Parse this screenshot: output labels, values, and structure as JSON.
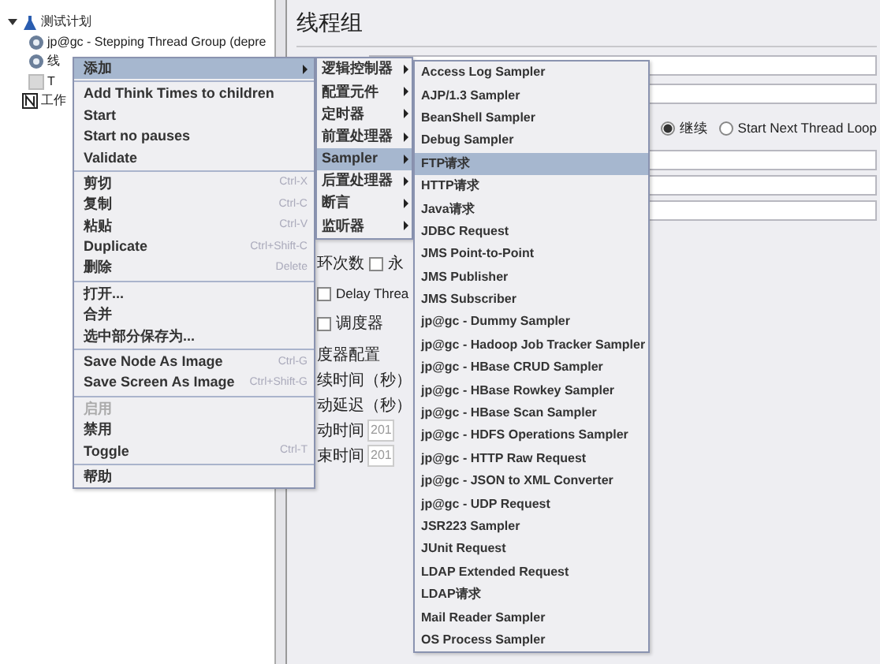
{
  "tree": [
    {
      "label": "测试计划",
      "kind": "plan",
      "expanded": true,
      "children": [
        {
          "label": "jp@gc - Stepping Thread Group (depre",
          "kind": "threads"
        },
        {
          "label": "线",
          "kind": "threads"
        },
        {
          "label": "T",
          "kind": "element"
        }
      ]
    },
    {
      "label": "工作",
      "kind": "workbench"
    }
  ],
  "panel": {
    "title": "线程组",
    "radios": [
      {
        "label": "继续",
        "selected": true
      },
      {
        "label": "Start Next Thread Loop",
        "selected": false
      }
    ],
    "loop_label": "环次数",
    "checkboxes": [
      {
        "label": "永",
        "checked": false
      },
      {
        "label": "Delay Threa",
        "checked": false
      },
      {
        "label": "调度器",
        "checked": false
      }
    ],
    "scheduler_config": "度器配置",
    "scheduler_fields": [
      {
        "label": "续时间（秒）"
      },
      {
        "label": "动延迟（秒）"
      },
      {
        "label": "动时间",
        "value": "201"
      },
      {
        "label": "束时间",
        "value": "201"
      }
    ]
  },
  "context_menu": [
    {
      "kind": "item",
      "label": "添加",
      "submenu": true,
      "selected": true,
      "disabled": false
    },
    {
      "kind": "separator"
    },
    {
      "kind": "item",
      "label": "Add Think Times to children",
      "selected": false,
      "disabled": false
    },
    {
      "kind": "item",
      "label": "Start",
      "selected": false,
      "disabled": false
    },
    {
      "kind": "item",
      "label": "Start no pauses",
      "selected": false,
      "disabled": false
    },
    {
      "kind": "item",
      "label": "Validate",
      "selected": false,
      "disabled": false
    },
    {
      "kind": "separator"
    },
    {
      "kind": "item",
      "label": "剪切",
      "shortcut": "Ctrl-X",
      "selected": false,
      "disabled": false
    },
    {
      "kind": "item",
      "label": "复制",
      "shortcut": "Ctrl-C",
      "selected": false,
      "disabled": false
    },
    {
      "kind": "item",
      "label": "粘贴",
      "shortcut": "Ctrl-V",
      "selected": false,
      "disabled": false
    },
    {
      "kind": "item",
      "label": "Duplicate",
      "shortcut": "Ctrl+Shift-C",
      "selected": false,
      "disabled": false
    },
    {
      "kind": "item",
      "label": "删除",
      "shortcut": "Delete",
      "selected": false,
      "disabled": false
    },
    {
      "kind": "separator"
    },
    {
      "kind": "item",
      "label": "打开...",
      "selected": false,
      "disabled": false
    },
    {
      "kind": "item",
      "label": "合并",
      "selected": false,
      "disabled": false
    },
    {
      "kind": "item",
      "label": "选中部分保存为...",
      "selected": false,
      "disabled": false
    },
    {
      "kind": "separator"
    },
    {
      "kind": "item",
      "label": "Save Node As Image",
      "shortcut": "Ctrl-G",
      "selected": false,
      "disabled": false
    },
    {
      "kind": "item",
      "label": "Save Screen As Image",
      "shortcut": "Ctrl+Shift-G",
      "selected": false,
      "disabled": false
    },
    {
      "kind": "separator"
    },
    {
      "kind": "item",
      "label": "启用",
      "selected": false,
      "disabled": true
    },
    {
      "kind": "item",
      "label": "禁用",
      "selected": false,
      "disabled": false
    },
    {
      "kind": "item",
      "label": "Toggle",
      "shortcut": "Ctrl-T",
      "selected": false,
      "disabled": false
    },
    {
      "kind": "separator"
    },
    {
      "kind": "item",
      "label": "帮助",
      "selected": false,
      "disabled": false
    }
  ],
  "add_submenu": [
    {
      "label": "逻辑控制器",
      "selected": false
    },
    {
      "label": "配置元件",
      "selected": false
    },
    {
      "label": "定时器",
      "selected": false
    },
    {
      "label": "前置处理器",
      "selected": false
    },
    {
      "label": "Sampler",
      "selected": true
    },
    {
      "label": "后置处理器",
      "selected": false
    },
    {
      "label": "断言",
      "selected": false
    },
    {
      "label": "监听器",
      "selected": false
    }
  ],
  "sampler_submenu": [
    {
      "label": "Access Log Sampler",
      "selected": false
    },
    {
      "label": "AJP/1.3 Sampler",
      "selected": false
    },
    {
      "label": "BeanShell Sampler",
      "selected": false
    },
    {
      "label": "Debug Sampler",
      "selected": false
    },
    {
      "label": "FTP请求",
      "selected": true
    },
    {
      "label": "HTTP请求",
      "selected": false
    },
    {
      "label": "Java请求",
      "selected": false
    },
    {
      "label": "JDBC Request",
      "selected": false
    },
    {
      "label": "JMS Point-to-Point",
      "selected": false
    },
    {
      "label": "JMS Publisher",
      "selected": false
    },
    {
      "label": "JMS Subscriber",
      "selected": false
    },
    {
      "label": "jp@gc - Dummy Sampler",
      "selected": false
    },
    {
      "label": "jp@gc - Hadoop Job Tracker Sampler",
      "selected": false
    },
    {
      "label": "jp@gc - HBase CRUD Sampler",
      "selected": false
    },
    {
      "label": "jp@gc - HBase Rowkey Sampler",
      "selected": false
    },
    {
      "label": "jp@gc - HBase Scan Sampler",
      "selected": false
    },
    {
      "label": "jp@gc - HDFS Operations Sampler",
      "selected": false
    },
    {
      "label": "jp@gc - HTTP Raw Request",
      "selected": false
    },
    {
      "label": "jp@gc - JSON to XML Converter",
      "selected": false
    },
    {
      "label": "jp@gc - UDP Request",
      "selected": false
    },
    {
      "label": "JSR223 Sampler",
      "selected": false
    },
    {
      "label": "JUnit Request",
      "selected": false
    },
    {
      "label": "LDAP Extended Request",
      "selected": false
    },
    {
      "label": "LDAP请求",
      "selected": false
    },
    {
      "label": "Mail Reader Sampler",
      "selected": false
    },
    {
      "label": "OS Process Sampler",
      "selected": false
    }
  ]
}
